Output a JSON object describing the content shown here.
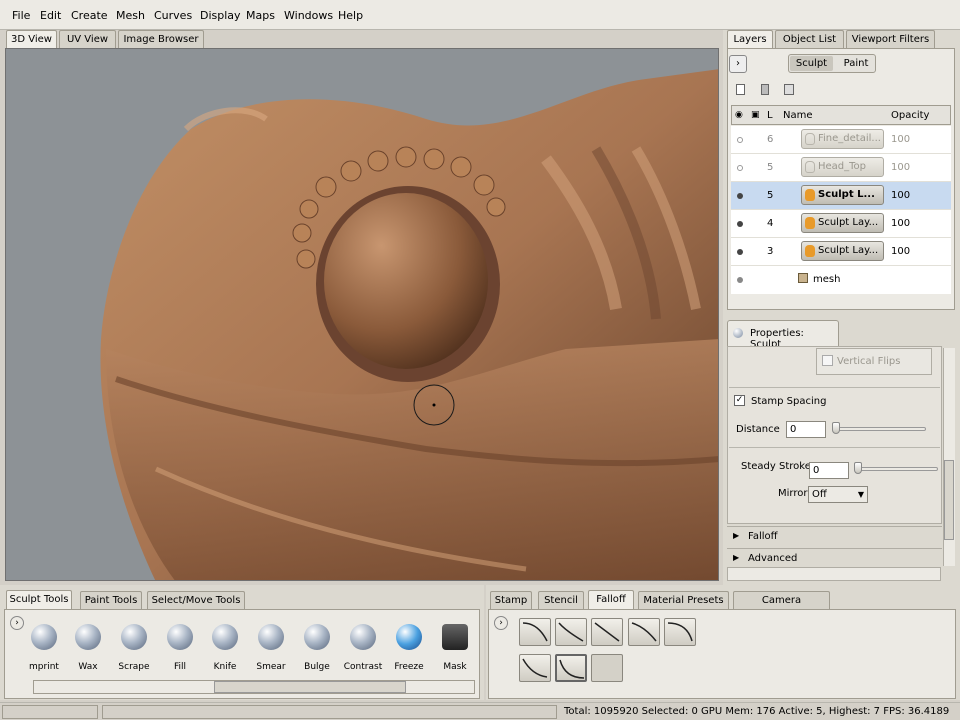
{
  "menu": [
    "File",
    "Edit",
    "Create",
    "Mesh",
    "Curves",
    "Display",
    "Maps",
    "Windows",
    "Help"
  ],
  "view_tabs": [
    "3D View",
    "UV View",
    "Image Browser"
  ],
  "right_tabs": [
    "Layers",
    "Object List",
    "Viewport Filters"
  ],
  "mode_toggle": {
    "sculpt": "Sculpt",
    "paint": "Paint"
  },
  "layers": {
    "header": {
      "name": "Name",
      "opacity": "Opacity",
      "lock_col": "L"
    },
    "rows": [
      {
        "num": "6",
        "name": "Fine_detail...",
        "opacity": "100",
        "dim": true,
        "selected": false
      },
      {
        "num": "5",
        "name": "Head_Top",
        "opacity": "100",
        "dim": true,
        "selected": false
      },
      {
        "num": "5",
        "name": "Sculpt L...",
        "opacity": "100",
        "dim": false,
        "selected": true
      },
      {
        "num": "4",
        "name": "Sculpt Lay...",
        "opacity": "100",
        "dim": false,
        "selected": false
      },
      {
        "num": "3",
        "name": "Sculpt Lay...",
        "opacity": "100",
        "dim": false,
        "selected": false
      }
    ],
    "mesh_label": "mesh"
  },
  "properties": {
    "title": "Properties: Sculpt",
    "vertical_flips": "Vertical Flips",
    "stamp_spacing": "Stamp Spacing",
    "distance_label": "Distance",
    "distance_value": "0",
    "steady_label": "Steady Stroke",
    "steady_value": "0",
    "mirror_label": "Mirror",
    "mirror_value": "Off",
    "falloff": "Falloff",
    "advanced": "Advanced"
  },
  "tool_tabs": [
    "Sculpt Tools",
    "Paint Tools",
    "Select/Move Tools"
  ],
  "tools": [
    "mprint",
    "Wax",
    "Scrape",
    "Fill",
    "Knife",
    "Smear",
    "Bulge",
    "Contrast",
    "Freeze",
    "Mask"
  ],
  "stamp_tabs": [
    "Stamp",
    "Stencil",
    "Falloff",
    "Material Presets",
    "Camera Bookmarks"
  ],
  "status": "Total: 1095920  Selected: 0 GPU Mem: 176  Active: 5, Highest: 7  FPS: 36.4189",
  "colors": {
    "clay": "#a87552",
    "viewport_bg": "#8d9296",
    "selected_row": "#c8daf0"
  }
}
